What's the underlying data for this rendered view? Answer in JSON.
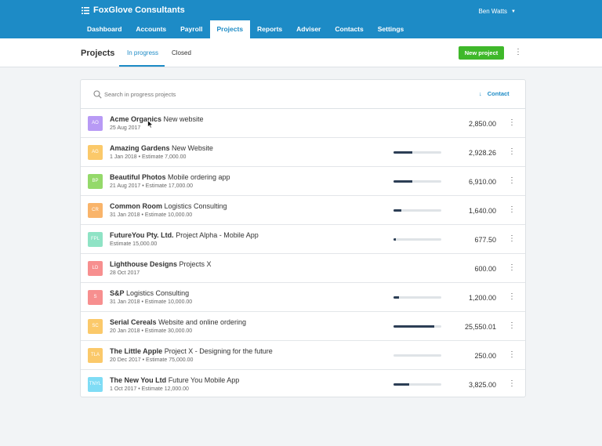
{
  "app": {
    "name": "FoxGlove Consultants",
    "user": "Ben Watts"
  },
  "nav": [
    "Dashboard",
    "Accounts",
    "Payroll",
    "Projects",
    "Reports",
    "Adviser",
    "Contacts",
    "Settings"
  ],
  "nav_active": "Projects",
  "subheader": {
    "title": "Projects",
    "tab_in_progress": "In progress",
    "tab_closed": "Closed",
    "new_project": "New project"
  },
  "search": {
    "placeholder": "Search in progress projects"
  },
  "sort": {
    "label": "Contact"
  },
  "colors": {
    "brand": "#1d8bc6",
    "green": "#3fb82a",
    "progress": "#2c3e55"
  },
  "projects": [
    {
      "initials": "AO",
      "color": "#b89af5",
      "client": "Acme Organics",
      "project": "New website",
      "meta": "25 Aug 2017",
      "progress": null,
      "amount": "2,850.00"
    },
    {
      "initials": "AG",
      "color": "#fbc96a",
      "client": "Amazing Gardens",
      "project": "New Website",
      "meta": "1 Jan 2018 • Estimate 7,000.00",
      "progress": 0.4,
      "amount": "2,928.26"
    },
    {
      "initials": "BP",
      "color": "#94d96a",
      "client": "Beautiful Photos",
      "project": "Mobile ordering app",
      "meta": "21 Aug 2017 • Estimate 17,000.00",
      "progress": 0.4,
      "amount": "6,910.00"
    },
    {
      "initials": "CR",
      "color": "#f9b46a",
      "client": "Common Room",
      "project": "Logistics Consulting",
      "meta": "31 Jan 2018 • Estimate 10,000.00",
      "progress": 0.16,
      "amount": "1,640.00"
    },
    {
      "initials": "FPL",
      "color": "#8fe3c5",
      "client": "FutureYou Pty. Ltd.",
      "project": "Project Alpha - Mobile App",
      "meta": "Estimate 15,000.00",
      "progress": 0.05,
      "amount": "677.50"
    },
    {
      "initials": "LD",
      "color": "#f78f8f",
      "client": "Lighthouse Designs",
      "project": "Projects X",
      "meta": "28 Oct 2017",
      "progress": null,
      "amount": "600.00"
    },
    {
      "initials": "S",
      "color": "#f78f8f",
      "client": "S&P",
      "project": "Logistics Consulting",
      "meta": "31 Jan 2018 • Estimate 10,000.00",
      "progress": 0.12,
      "amount": "1,200.00"
    },
    {
      "initials": "SC",
      "color": "#fbc96a",
      "client": "Serial Cereals",
      "project": "Website and online ordering",
      "meta": "20 Jan 2018 • Estimate 30,000.00",
      "progress": 0.85,
      "amount": "25,550.01"
    },
    {
      "initials": "TLA",
      "color": "#fbc96a",
      "client": "The Little Apple",
      "project": "Project X - Designing for the future",
      "meta": "20 Dec 2017 • Estimate 75,000.00",
      "progress": 0.0,
      "amount": "250.00"
    },
    {
      "initials": "TNYL",
      "color": "#7fdcf5",
      "client": "The New You Ltd",
      "project": "Future You Mobile App",
      "meta": "1 Oct 2017 • Estimate 12,000.00",
      "progress": 0.32,
      "amount": "3,825.00"
    }
  ]
}
